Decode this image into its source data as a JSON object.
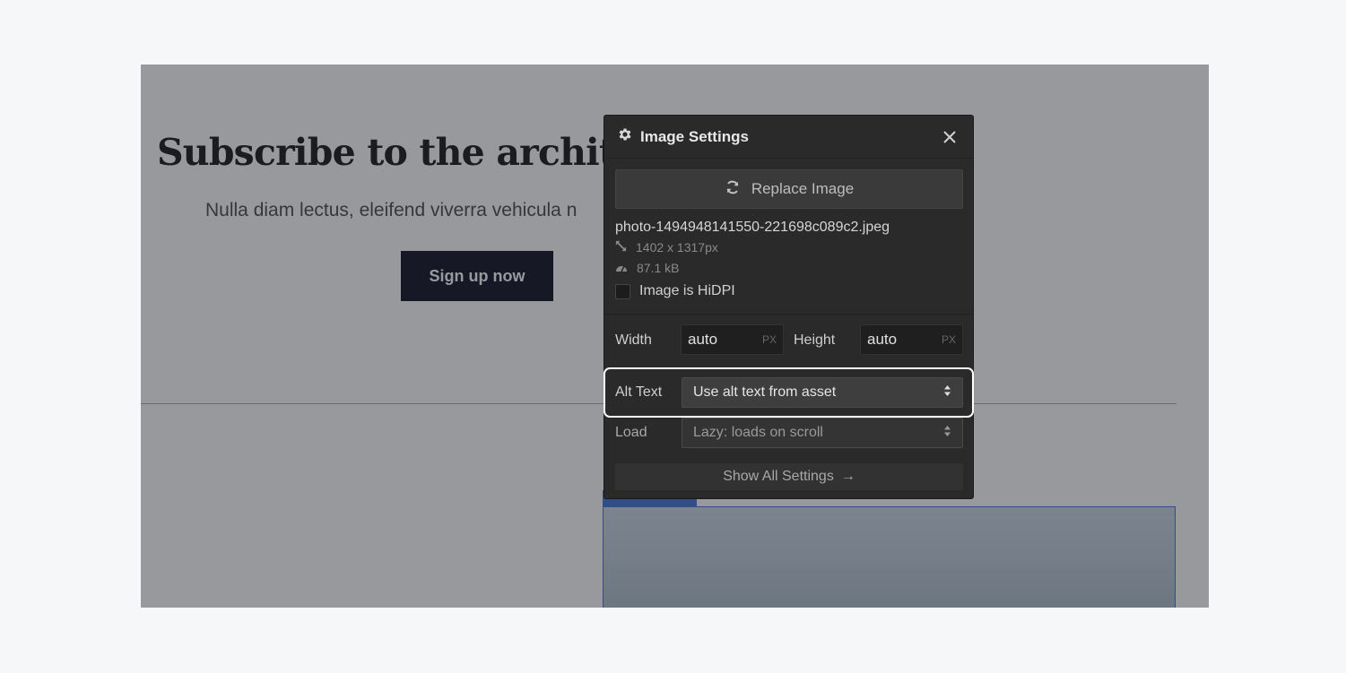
{
  "canvas": {
    "heading": "Subscribe to the architect",
    "subtext": "Nulla diam lectus, eleifend viverra vehicula n",
    "cta_label": "Sign up now"
  },
  "panel": {
    "title": "Image Settings",
    "replace_label": "Replace Image",
    "filename": "photo-1494948141550-221698c089c2.jpeg",
    "dimensions": "1402 x 1317px",
    "filesize": "87.1 kB",
    "hidpi_label": "Image is HiDPI",
    "width_label": "Width",
    "width_value": "auto",
    "width_unit": "PX",
    "height_label": "Height",
    "height_value": "auto",
    "height_unit": "PX",
    "alt_label": "Alt Text",
    "alt_value": "Use alt text from asset",
    "load_label": "Load",
    "load_value": "Lazy: loads on scroll",
    "show_all_label": "Show All Settings",
    "show_all_arrow": "→"
  },
  "icons": [
    "gear-icon",
    "close-icon",
    "refresh-icon",
    "resize-icon",
    "gauge-icon",
    "updown-arrows-icon",
    "arrow-right-icon"
  ],
  "colors": {
    "panel_bg": "#2a2a2a",
    "cta_bg": "#08091a",
    "selection_blue": "#3a6fd8",
    "highlight": "#ffffff"
  }
}
